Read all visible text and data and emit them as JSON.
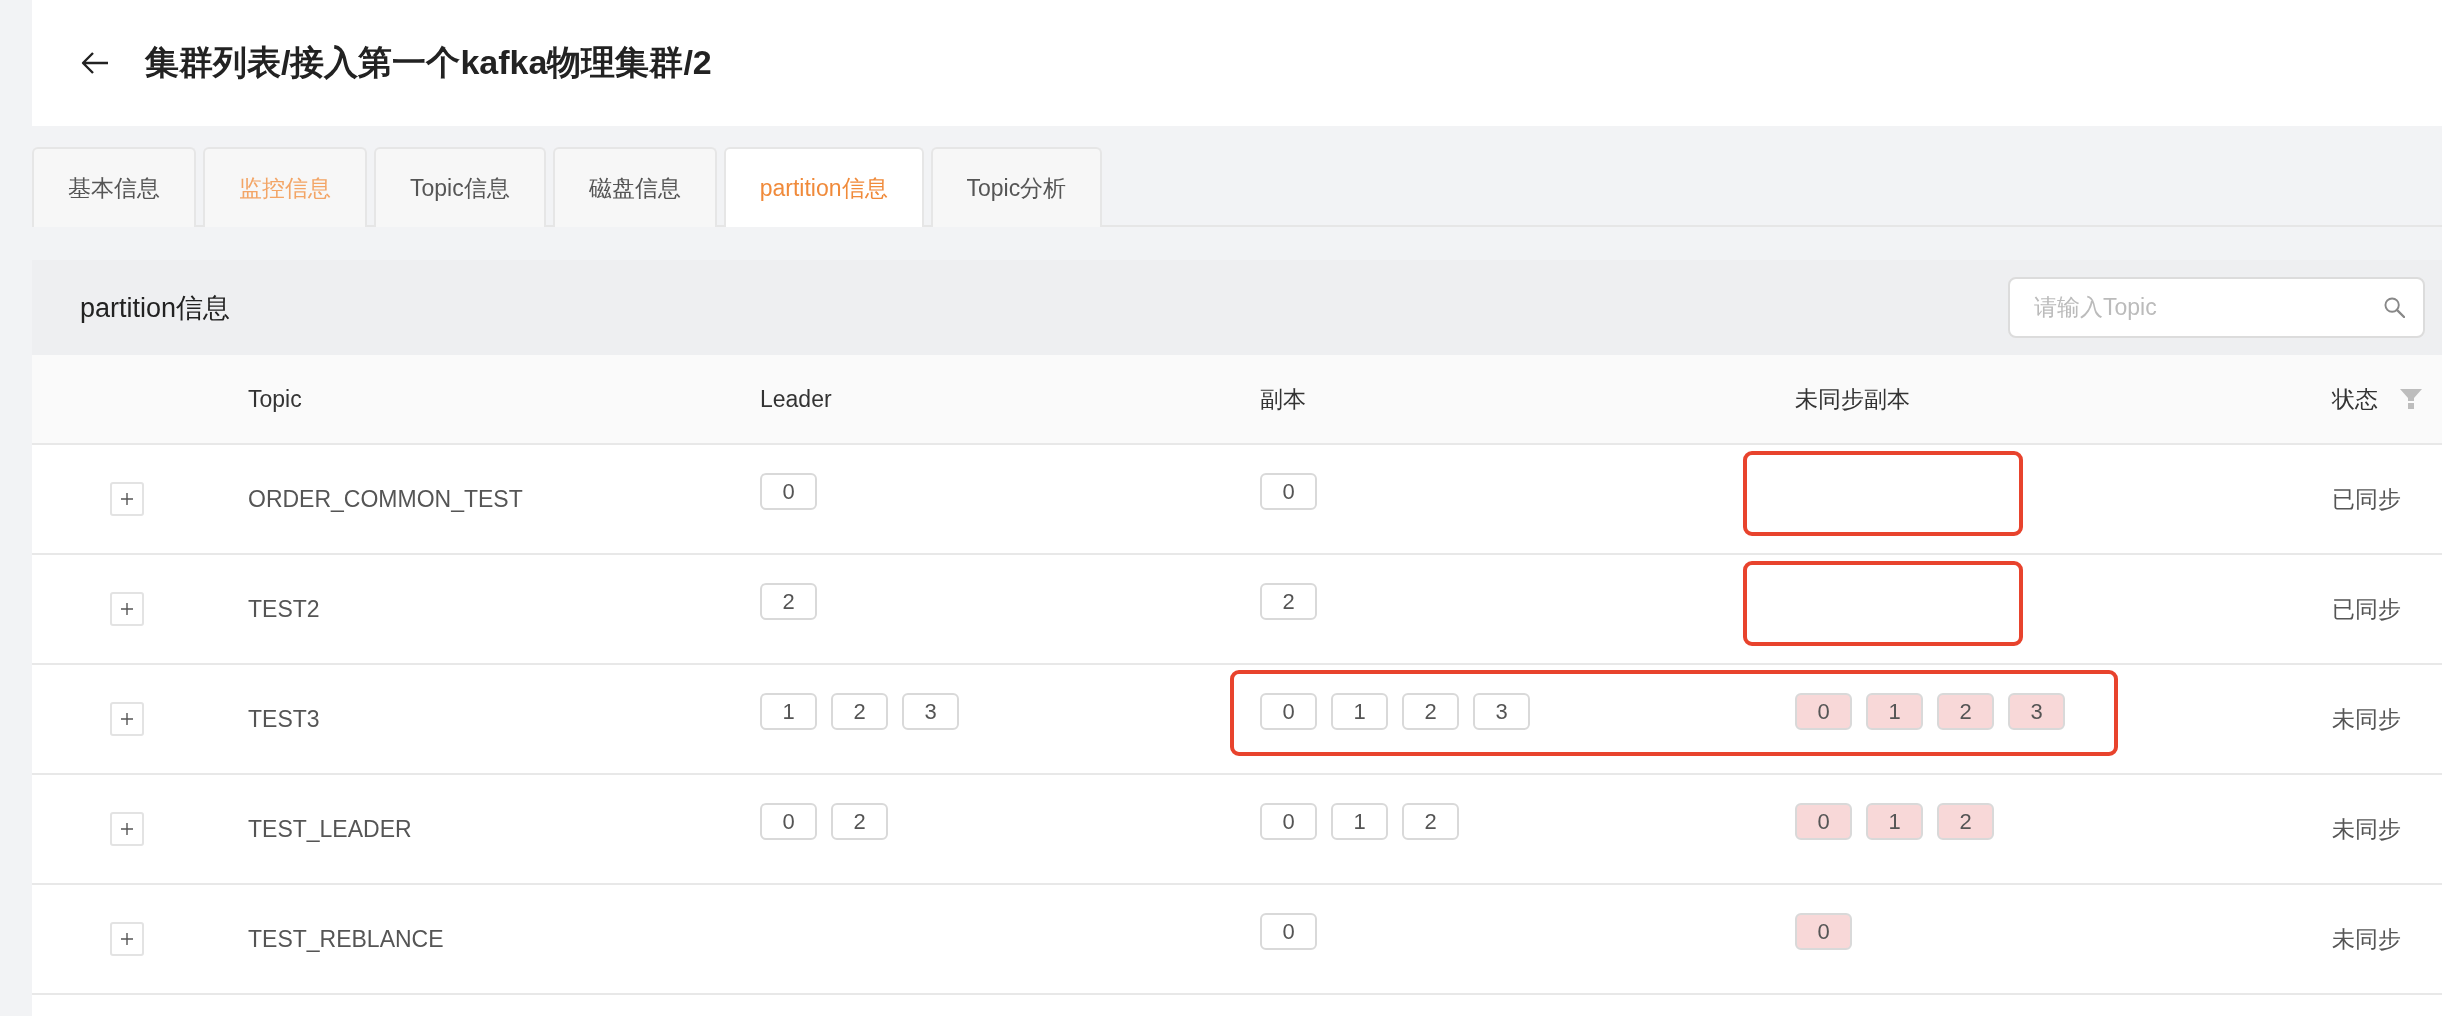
{
  "header": {
    "title": "集群列表/接入第一个kafka物理集群/2"
  },
  "tabs": [
    {
      "label": "基本信息",
      "selected": false,
      "hovered": false
    },
    {
      "label": "监控信息",
      "selected": false,
      "hovered": true
    },
    {
      "label": "Topic信息",
      "selected": false,
      "hovered": false
    },
    {
      "label": "磁盘信息",
      "selected": false,
      "hovered": false
    },
    {
      "label": "partition信息",
      "selected": true,
      "hovered": false
    },
    {
      "label": "Topic分析",
      "selected": false,
      "hovered": false
    }
  ],
  "panel": {
    "title": "partition信息",
    "search": {
      "placeholder": "请输入Topic"
    }
  },
  "table": {
    "columns": [
      {
        "kind": "text",
        "label": "Topic"
      },
      {
        "kind": "tags",
        "label": "Leader"
      },
      {
        "kind": "tags",
        "label": "副本"
      },
      {
        "kind": "alert-tags",
        "label": "未同步副本"
      },
      {
        "kind": "text",
        "label": "状态",
        "filter": true
      }
    ],
    "rows": [
      {
        "cells": [
          {
            "text": "ORDER_COMMON_TEST",
            "highlighted": false
          },
          {
            "tags": [
              "0"
            ],
            "highlighted": false
          },
          {
            "tags": [
              "0"
            ],
            "highlighted": false
          },
          {
            "highlighted": true
          },
          {
            "text": "已同步",
            "highlighted": false
          }
        ]
      },
      {
        "cells": [
          {
            "text": "TEST2",
            "highlighted": false
          },
          {
            "tags": [
              "2"
            ],
            "highlighted": false
          },
          {
            "tags": [
              "2"
            ],
            "highlighted": false
          },
          {
            "highlighted": true
          },
          {
            "text": "已同步",
            "highlighted": false
          }
        ]
      },
      {
        "cells": [
          {
            "text": "TEST3",
            "highlighted": false
          },
          {
            "tags": [
              "1",
              "2",
              "3"
            ],
            "highlighted": false
          },
          {
            "tags": [
              "0",
              "1",
              "2",
              "3"
            ],
            "highlighted": true
          },
          {
            "tags": [
              "0",
              "1",
              "2",
              "3"
            ],
            "highlighted": true
          },
          {
            "text": "未同步",
            "highlighted": false
          }
        ]
      },
      {
        "cells": [
          {
            "text": "TEST_LEADER",
            "highlighted": false
          },
          {
            "tags": [
              "0",
              "2"
            ],
            "highlighted": false
          },
          {
            "tags": [
              "0",
              "1",
              "2"
            ],
            "highlighted": false
          },
          {
            "tags": [
              "0",
              "1",
              "2"
            ],
            "highlighted": false
          },
          {
            "text": "未同步",
            "highlighted": false
          }
        ]
      },
      {
        "cells": [
          {
            "text": "TEST_REBLANCE",
            "highlighted": false
          },
          {
            "highlighted": false
          },
          {
            "tags": [
              "0"
            ],
            "highlighted": false
          },
          {
            "tags": [
              "0"
            ],
            "highlighted": false
          },
          {
            "text": "未同步",
            "highlighted": false
          }
        ]
      }
    ]
  }
}
